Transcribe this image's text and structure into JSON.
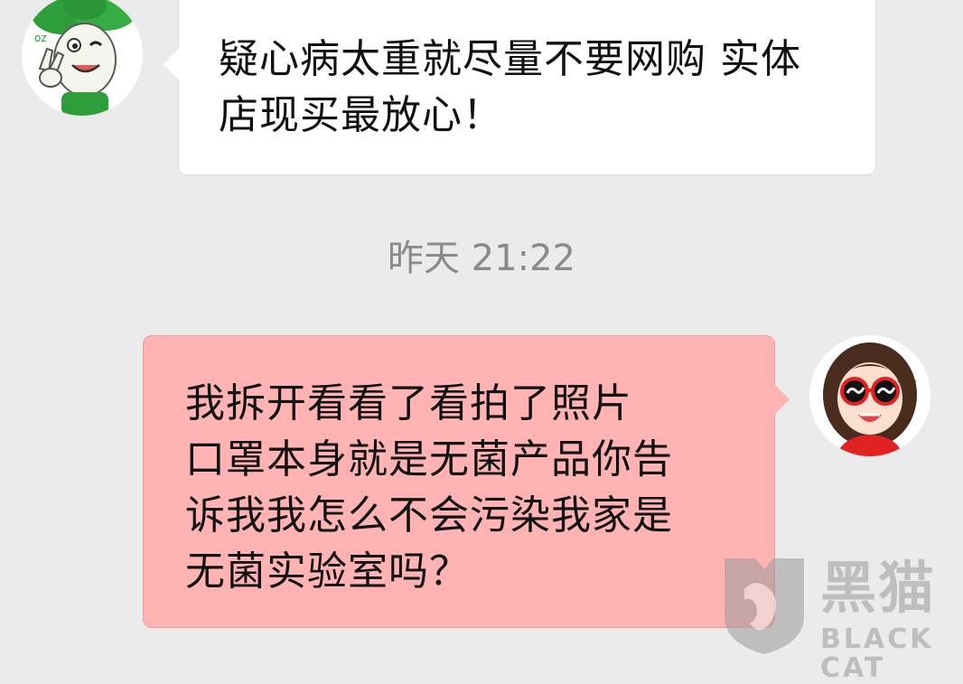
{
  "messages": [
    {
      "side": "left",
      "text": "疑心病太重就尽量不要网购 实体\n店现买最放心！"
    },
    {
      "side": "right",
      "text": "我拆开看看了看拍了照片\n口罩本身就是无菌产品你告\n诉我我怎么不会污染我家是\n无菌实验室吗？"
    }
  ],
  "timestamp": "昨天 21:22",
  "watermark": {
    "cn": "黑猫",
    "en": "BLACK CAT"
  },
  "avatars": {
    "left": "cartoon-mascot-avatar",
    "right": "girl-sunglasses-avatar"
  },
  "colors": {
    "background": "#ebebeb",
    "incoming_bubble": "#ffffff",
    "outgoing_bubble": "#ffb3b3",
    "timestamp": "#8a8a8a"
  }
}
